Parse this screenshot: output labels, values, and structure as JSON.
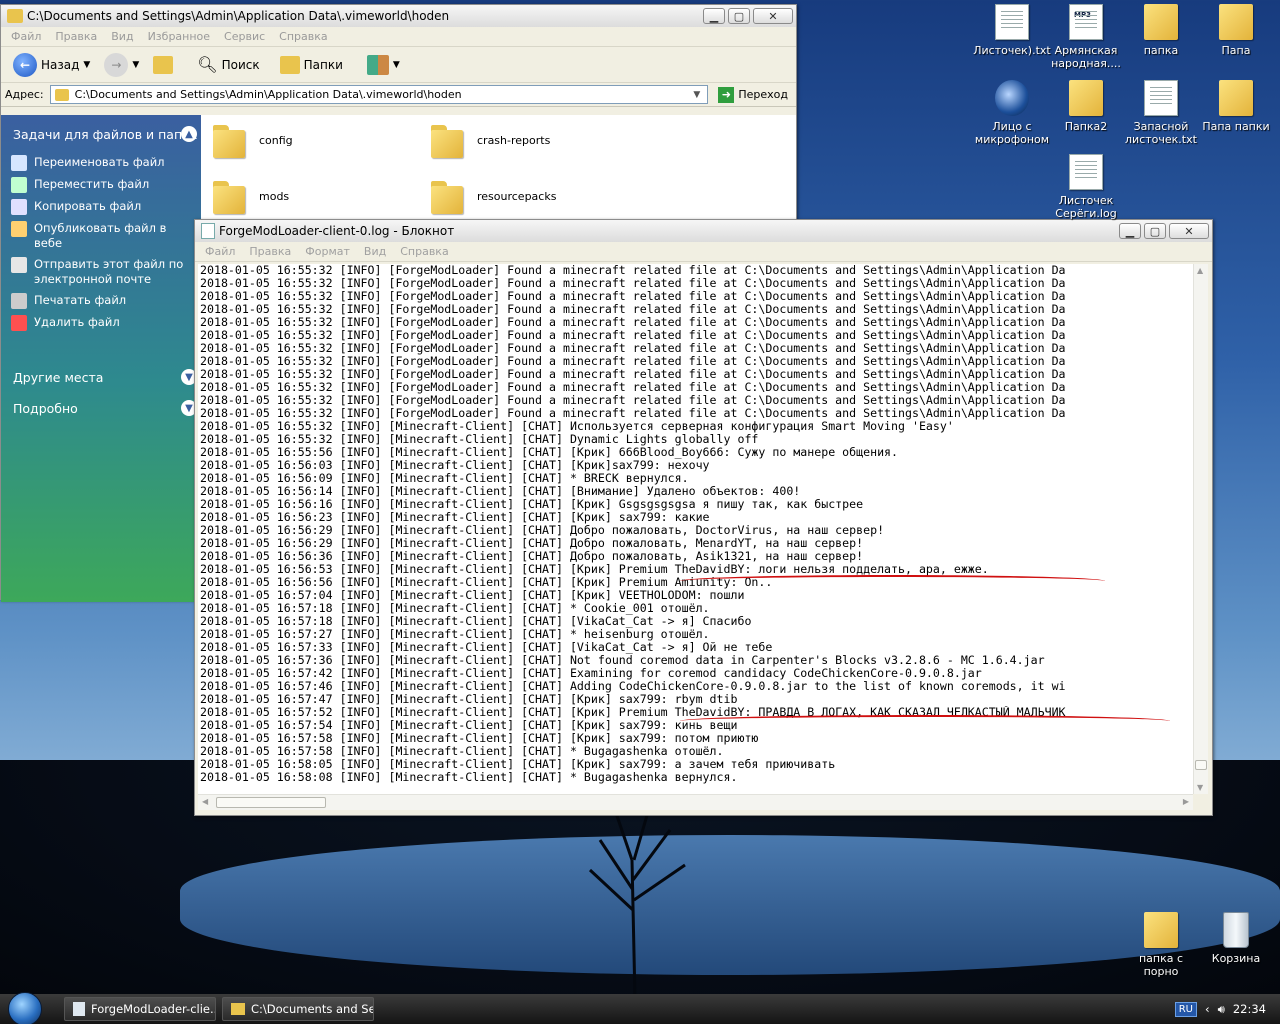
{
  "explorer": {
    "title": "C:\\Documents and Settings\\Admin\\Application Data\\.vimeworld\\hoden",
    "menu": [
      "Файл",
      "Правка",
      "Вид",
      "Избранное",
      "Сервис",
      "Справка"
    ],
    "back": "Назад",
    "search": "Поиск",
    "folders_btn": "Папки",
    "address_label": "Адрес:",
    "address": "C:\\Documents and Settings\\Admin\\Application Data\\.vimeworld\\hoden",
    "go": "Переход",
    "tasks_header": "Задачи для файлов и папок",
    "tasks": [
      {
        "label": "Переименовать файл",
        "color": "#d6e6ff"
      },
      {
        "label": "Переместить файл",
        "color": "#c0ffd0"
      },
      {
        "label": "Копировать файл",
        "color": "#e0e0ff"
      },
      {
        "label": "Опубликовать файл в вебе",
        "color": "#ffd070"
      },
      {
        "label": "Отправить этот файл по электронной почте",
        "color": "#e6e6e6"
      },
      {
        "label": "Печатать файл",
        "color": "#cccccc"
      },
      {
        "label": "Удалить файл",
        "color": "#ff5050"
      }
    ],
    "other_places": "Другие места",
    "details": "Подробно",
    "items": [
      "config",
      "crash-reports",
      "mods",
      "resourcepacks"
    ]
  },
  "notepad": {
    "title": "ForgeModLoader-client-0.log - Блокнот",
    "menu": [
      "Файл",
      "Правка",
      "Формат",
      "Вид",
      "Справка"
    ],
    "lines": [
      "2018-01-05 16:55:32 [INFO] [ForgeModLoader] Found a minecraft related file at C:\\Documents and Settings\\Admin\\Application Da",
      "2018-01-05 16:55:32 [INFO] [ForgeModLoader] Found a minecraft related file at C:\\Documents and Settings\\Admin\\Application Da",
      "2018-01-05 16:55:32 [INFO] [ForgeModLoader] Found a minecraft related file at C:\\Documents and Settings\\Admin\\Application Da",
      "2018-01-05 16:55:32 [INFO] [ForgeModLoader] Found a minecraft related file at C:\\Documents and Settings\\Admin\\Application Da",
      "2018-01-05 16:55:32 [INFO] [ForgeModLoader] Found a minecraft related file at C:\\Documents and Settings\\Admin\\Application Da",
      "2018-01-05 16:55:32 [INFO] [ForgeModLoader] Found a minecraft related file at C:\\Documents and Settings\\Admin\\Application Da",
      "2018-01-05 16:55:32 [INFO] [ForgeModLoader] Found a minecraft related file at C:\\Documents and Settings\\Admin\\Application Da",
      "2018-01-05 16:55:32 [INFO] [ForgeModLoader] Found a minecraft related file at C:\\Documents and Settings\\Admin\\Application Da",
      "2018-01-05 16:55:32 [INFO] [ForgeModLoader] Found a minecraft related file at C:\\Documents and Settings\\Admin\\Application Da",
      "2018-01-05 16:55:32 [INFO] [ForgeModLoader] Found a minecraft related file at C:\\Documents and Settings\\Admin\\Application Da",
      "2018-01-05 16:55:32 [INFO] [ForgeModLoader] Found a minecraft related file at C:\\Documents and Settings\\Admin\\Application Da",
      "2018-01-05 16:55:32 [INFO] [ForgeModLoader] Found a minecraft related file at C:\\Documents and Settings\\Admin\\Application Da",
      "2018-01-05 16:55:32 [INFO] [Minecraft-Client] [CHAT] Используется серверная конфигурация Smart Moving 'Easy'",
      "2018-01-05 16:55:32 [INFO] [Minecraft-Client] [CHAT] Dynamic Lights globally off",
      "2018-01-05 16:55:56 [INFO] [Minecraft-Client] [CHAT] [Крик] 666Blood_Boy666: Сужу по манере общения.",
      "2018-01-05 16:56:03 [INFO] [Minecraft-Client] [CHAT] [Крик]sax799: нехочу",
      "2018-01-05 16:56:09 [INFO] [Minecraft-Client] [CHAT] * BRECK вернулся.",
      "2018-01-05 16:56:14 [INFO] [Minecraft-Client] [CHAT] [Внимание] Удалено объектов: 400!",
      "2018-01-05 16:56:16 [INFO] [Minecraft-Client] [CHAT] [Крик] Gsgsgsgsgsa я пишу так, как быстрее",
      "2018-01-05 16:56:23 [INFO] [Minecraft-Client] [CHAT] [Крик] sax799: какие",
      "2018-01-05 16:56:29 [INFO] [Minecraft-Client] [CHAT] Добро пожаловать, DoctorVirus, на наш сервер!",
      "2018-01-05 16:56:29 [INFO] [Minecraft-Client] [CHAT] Добро пожаловать, MenardYT, на наш сервер!",
      "2018-01-05 16:56:36 [INFO] [Minecraft-Client] [CHAT] Добро пожаловать, Asik1321, на наш сервер!",
      "2018-01-05 16:56:53 [INFO] [Minecraft-Client] [CHAT] [Крик] Premium TheDavidBY: логи нельзя подделать, ара, ежже.",
      "2018-01-05 16:56:56 [INFO] [Minecraft-Client] [CHAT] [Крик] Premium Amiunity: On..",
      "2018-01-05 16:57:04 [INFO] [Minecraft-Client] [CHAT] [Крик] VEETHOLODOM: пошли",
      "2018-01-05 16:57:18 [INFO] [Minecraft-Client] [CHAT] * Cookie_001 отошёл.",
      "2018-01-05 16:57:18 [INFO] [Minecraft-Client] [CHAT] [VikaCat_Cat -> я] Спасибо",
      "2018-01-05 16:57:27 [INFO] [Minecraft-Client] [CHAT] * heisenburg отошёл.",
      "2018-01-05 16:57:33 [INFO] [Minecraft-Client] [CHAT] [VikaCat_Cat -> я] Ой не тебе",
      "2018-01-05 16:57:36 [INFO] [Minecraft-Client] [CHAT] Not found coremod data in Carpenter's Blocks v3.2.8.6 - MC 1.6.4.jar",
      "2018-01-05 16:57:42 [INFO] [Minecraft-Client] [CHAT] Examining for coremod candidacy CodeChickenCore-0.9.0.8.jar",
      "2018-01-05 16:57:46 [INFO] [Minecraft-Client] [CHAT] Adding CodeChickenCore-0.9.0.8.jar to the list of known coremods, it wi",
      "2018-01-05 16:57:47 [INFO] [Minecraft-Client] [CHAT] [Крик] sax799: rbym dtib",
      "2018-01-05 16:57:52 [INFO] [Minecraft-Client] [CHAT] [Крик] Premium TheDavidBY: ПРАВДА В ЛОГАХ, КАК СКАЗАЛ ЧЕЛКАСТЫЙ МАЛЬЧИК",
      "2018-01-05 16:57:54 [INFO] [Minecraft-Client] [CHAT] [Крик] sax799: кинь вещи",
      "2018-01-05 16:57:58 [INFO] [Minecraft-Client] [CHAT] [Крик] sax799: потом приютю",
      "2018-01-05 16:57:58 [INFO] [Minecraft-Client] [CHAT] * Bugagashenka отошёл.",
      "2018-01-05 16:58:05 [INFO] [Minecraft-Client] [CHAT] [Крик] sax799: а зачем тебя приючивать",
      "2018-01-05 16:58:08 [INFO] [Minecraft-Client] [CHAT] * Bugagashenka вернулся."
    ]
  },
  "desktop": [
    {
      "label": "Листочек).txt",
      "type": "txt"
    },
    {
      "label": "Армянская народная....",
      "type": "mp3",
      "badge": "MP3"
    },
    {
      "label": "папка",
      "type": "folder"
    },
    {
      "label": "Папа",
      "type": "folder"
    },
    {
      "label": "Лицо с микрофоном",
      "type": "media"
    },
    {
      "label": "Папка2",
      "type": "folder"
    },
    {
      "label": "Запасной листочек.txt",
      "type": "txt"
    },
    {
      "label": "Папа папки",
      "type": "folder"
    },
    {
      "label": "Листочек Серёги.log",
      "type": "txt"
    },
    {
      "label": "папка с порно",
      "type": "folder"
    },
    {
      "label": "Корзина",
      "type": "bin"
    }
  ],
  "taskbar": {
    "tasks": [
      "ForgeModLoader-clie...",
      "C:\\Documents and Se..."
    ],
    "lang": "RU",
    "clock": "22:34"
  }
}
